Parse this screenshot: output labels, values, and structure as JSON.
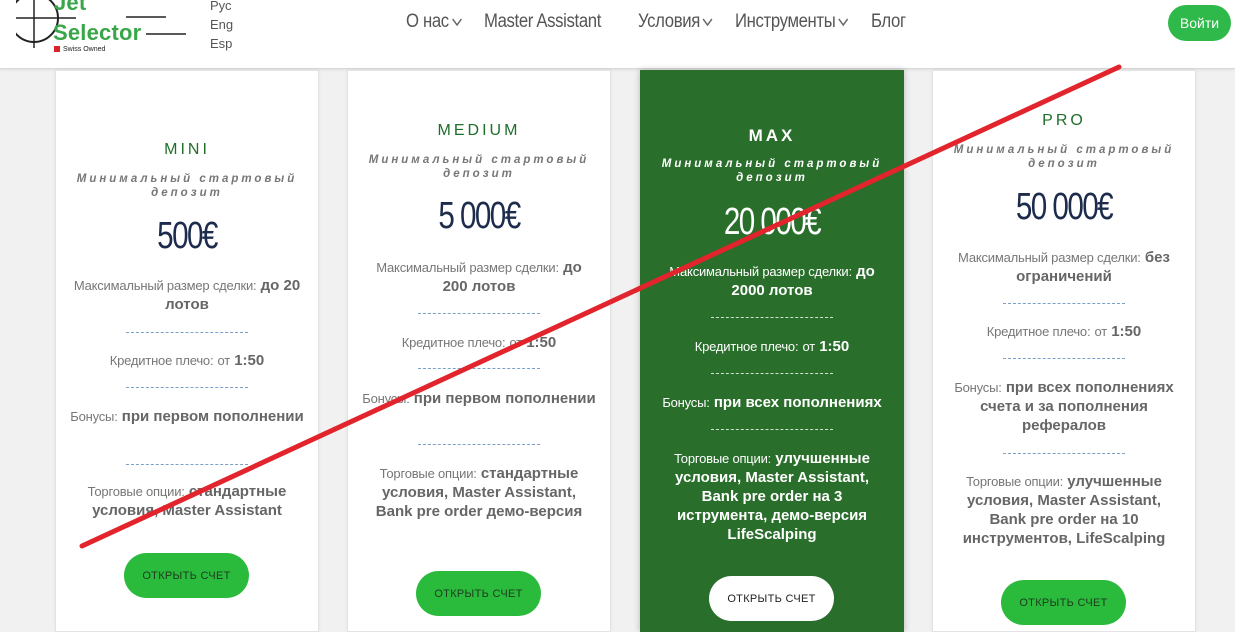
{
  "header": {
    "logo": {
      "line1": "Jet",
      "line2": "Selector",
      "tagline": "Swiss Owned"
    },
    "languages": [
      "Рус",
      "Eng",
      "Esp"
    ],
    "nav": [
      {
        "label": "О нас",
        "dropdown": true
      },
      {
        "label": "Master Assistant",
        "dropdown": false
      },
      {
        "label": "Условия",
        "dropdown": true
      },
      {
        "label": "Инструменты",
        "dropdown": true
      },
      {
        "label": "Блог",
        "dropdown": false
      }
    ],
    "login_label": "Войти"
  },
  "plans": [
    {
      "name": "MINI",
      "subtitle": "Минимальный стартовый депозит",
      "price": "500€",
      "max_deal_label": "Максимальный размер сделки:",
      "max_deal_value": "до 20 лотов",
      "leverage_label": "Кредитное плечо:",
      "leverage_prefix": "от",
      "leverage_value": "1:50",
      "bonus_label": "Бонусы:",
      "bonus_value": "при первом пополнении",
      "options_label": "Торговые опции:",
      "options_value": "стандартные условия, Master Assistant",
      "button": "ОТКРЫТЬ СЧЕТ"
    },
    {
      "name": "MEDIUM",
      "subtitle": "Минимальный стартовый депозит",
      "price": "5 000€",
      "max_deal_label": "Максимальный размер сделки:",
      "max_deal_value": "до 200 лотов",
      "leverage_label": "Кредитное плечо:",
      "leverage_prefix": "от",
      "leverage_value": "1:50",
      "bonus_label": "Бонусы:",
      "bonus_value": "при первом пополнении",
      "options_label": "Торговые опции:",
      "options_value": "стандартные условия, Master Assistant, Bank pre order демо-версия",
      "button": "ОТКРЫТЬ СЧЕТ"
    },
    {
      "name": "MAX",
      "subtitle": "Минимальный стартовый депозит",
      "price": "20 000€",
      "max_deal_label": "Максимальный размер сделки:",
      "max_deal_value": "до 2000 лотов",
      "leverage_label": "Кредитное плечо:",
      "leverage_prefix": "от",
      "leverage_value": "1:50",
      "bonus_label": "Бонусы:",
      "bonus_value": "при всех пополнениях",
      "options_label": "Торговые опции:",
      "options_value": "улучшенные условия, Master Assistant, Bank pre order на 3 иструмента, демо-версия LifeScalping",
      "button": "ОТКРЫТЬ СЧЕТ"
    },
    {
      "name": "PRO",
      "subtitle": "Минимальный стартовый депозит",
      "price": "50 000€",
      "max_deal_label": "Максимальный размер сделки:",
      "max_deal_value": "без ограничений",
      "leverage_label": "Кредитное плечо:",
      "leverage_prefix": "от",
      "leverage_value": "1:50",
      "bonus_label": "Бонусы:",
      "bonus_value": "при всех пополнениях счета и за пополнения рефералов",
      "options_label": "Торговые опции:",
      "options_value": "улучшенные условия, Master Assistant, Bank pre order на 10 инструментов, LifeScalping",
      "button": "ОТКРЫТЬ СЧЕТ"
    }
  ],
  "colors": {
    "brand_green": "#3aa64a",
    "featured_bg": "#2a6e2c",
    "button_green": "#2bbb3c",
    "price_navy": "#1d2b4c",
    "strike_red": "#e2242c"
  },
  "icons": [
    "crosshair-logo-icon",
    "chevron-down-icon"
  ]
}
